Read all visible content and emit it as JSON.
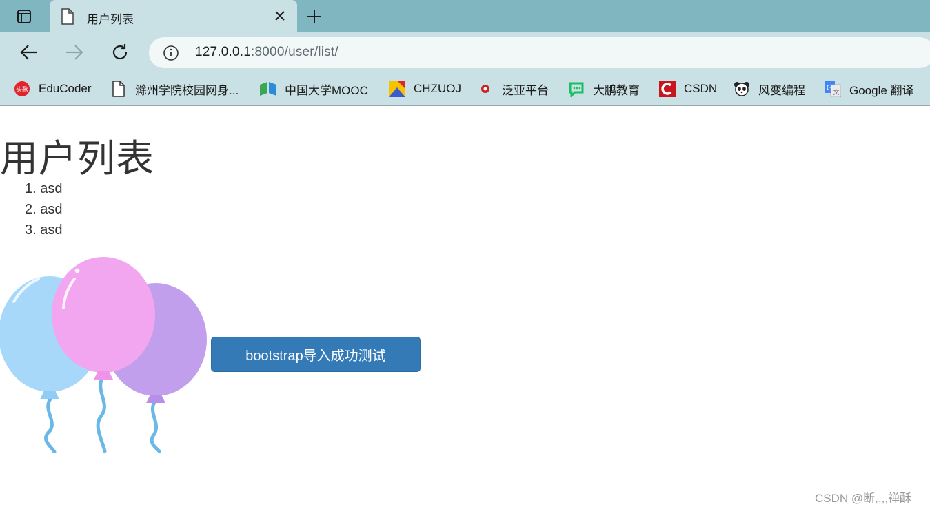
{
  "browser": {
    "tab": {
      "title": "用户列表",
      "favicon": "document-icon"
    },
    "address": {
      "host": "127.0.0.1",
      "rest": ":8000/user/list/"
    },
    "bookmarks": [
      {
        "label": "EduCoder",
        "icon": "educoder-icon",
        "color": "#e0242b"
      },
      {
        "label": "滁州学院校园网身...",
        "icon": "document-icon",
        "color": "#333333"
      },
      {
        "label": "中国大学MOOC",
        "icon": "mooc-icon",
        "color": "#2a8bd8"
      },
      {
        "label": "CHZUOJ",
        "icon": "chzuoj-icon",
        "color": "#f5c300"
      },
      {
        "label": "泛亚平台",
        "icon": "fanya-icon",
        "color": "#cc2222"
      },
      {
        "label": "大鹏教育",
        "icon": "dapeng-icon",
        "color": "#18c060"
      },
      {
        "label": "CSDN",
        "icon": "csdn-icon",
        "color": "#c8161d"
      },
      {
        "label": "风变编程",
        "icon": "panda-icon",
        "color": "#333333"
      },
      {
        "label": "Google 翻译",
        "icon": "google-translate-icon",
        "color": "#4285f4"
      }
    ]
  },
  "page": {
    "title": "用户列表",
    "users": [
      "1. asd",
      "2. asd",
      "3. asd"
    ],
    "button_label": "bootstrap导入成功测试",
    "watermark": "CSDN @断,,,,禅酥"
  },
  "colors": {
    "tabstrip": "#7fb6c0",
    "toolbar": "#c9e0e4",
    "button": "#337ab7"
  }
}
